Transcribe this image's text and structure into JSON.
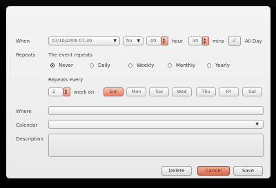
{
  "labels": {
    "when": "When",
    "repeats": "Repeats",
    "event_repeats": "The event repeats",
    "repeats_every": "Repeats every",
    "week_on": "week on",
    "where": "Where",
    "calendar": "Calendar",
    "description": "Description",
    "hour": "hour",
    "mins": "mins",
    "all_day": "All Day"
  },
  "when": {
    "datetime": "07/10/2009 07:30",
    "duration_prefix": "for",
    "hours": "00",
    "minutes": "30",
    "all_day_checked": true
  },
  "repeat_options": [
    {
      "label": "Never",
      "selected": true
    },
    {
      "label": "Daily",
      "selected": false
    },
    {
      "label": "Weekly",
      "selected": false
    },
    {
      "label": "Monthly",
      "selected": false
    },
    {
      "label": "Yearly",
      "selected": false
    }
  ],
  "repeat_interval": "2",
  "days": [
    {
      "label": "Sun",
      "selected": true
    },
    {
      "label": "Mon",
      "selected": false
    },
    {
      "label": "Tue",
      "selected": false
    },
    {
      "label": "Wed",
      "selected": false
    },
    {
      "label": "Thu",
      "selected": false
    },
    {
      "label": "Fri",
      "selected": false
    },
    {
      "label": "Sat",
      "selected": false
    }
  ],
  "fields": {
    "where_value": "",
    "calendar_value": "",
    "description_value": ""
  },
  "buttons": {
    "delete": "Delete",
    "cancel": "Cancel",
    "save": "Save"
  },
  "colors": {
    "accent": "#e07e62",
    "panel": "#eeeeee"
  },
  "icons": {
    "dropdown": "chevron-down-icon",
    "stepper": "stepper-icon",
    "check": "checkmark-icon"
  }
}
